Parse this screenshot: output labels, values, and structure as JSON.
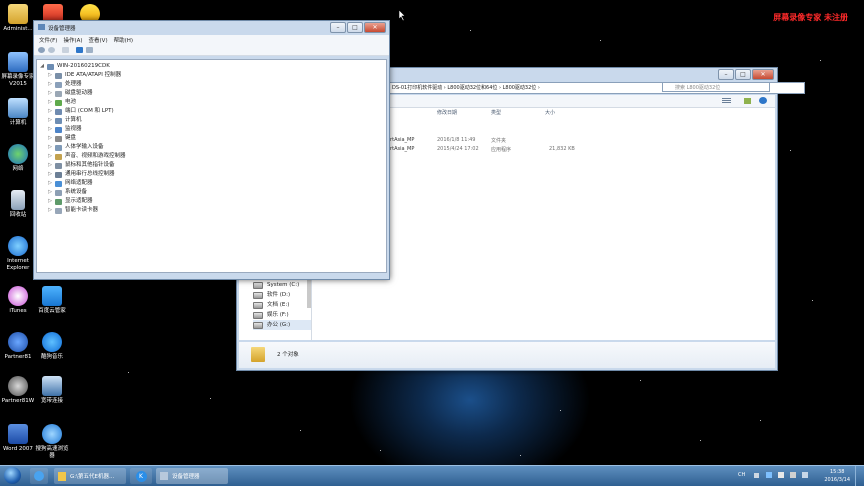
{
  "desktop": {
    "watermark": "屏幕录像专家  未注册",
    "icons": [
      {
        "label": "Administ...",
        "icon": "user-folder-icon"
      },
      {
        "label": "",
        "icon": "app-red-icon"
      },
      {
        "label": "",
        "icon": "app-yellow-icon"
      },
      {
        "label": "屏幕录像专家\nV2015",
        "icon": "screen-recorder-icon"
      },
      {
        "label": "计算机",
        "icon": "computer-icon"
      },
      {
        "label": "网络",
        "icon": "network-icon"
      },
      {
        "label": "回收站",
        "icon": "recycle-bin-icon"
      },
      {
        "label": "Internet\nExplorer",
        "icon": "ie-icon"
      },
      {
        "label": "iTunes",
        "icon": "itunes-icon"
      },
      {
        "label": "百度云管家",
        "icon": "baidu-cloud-icon"
      },
      {
        "label": "Partner81",
        "icon": "partner-icon"
      },
      {
        "label": "酷狗音乐",
        "icon": "kugou-icon"
      },
      {
        "label": "Partner81W",
        "icon": "wordpress-icon"
      },
      {
        "label": "宽带连接",
        "icon": "broadband-icon"
      },
      {
        "label": "Word 2007",
        "icon": "word-icon"
      },
      {
        "label": "搜狗高速浏览\n器",
        "icon": "sogou-icon"
      }
    ]
  },
  "devmgr": {
    "title": "设备管理器",
    "menus": [
      "文件(F)",
      "操作(A)",
      "查看(V)",
      "帮助(H)"
    ],
    "root": "WIN-20160219CDK",
    "nodes": [
      "IDE ATA/ATAPI 控制器",
      "处理器",
      "磁盘驱动器",
      "电池",
      "端口 (COM 和 LPT)",
      "计算机",
      "监视器",
      "键盘",
      "人体学输入设备",
      "声音、视频和游戏控制器",
      "鼠标和其他指针设备",
      "通用串行总线控制器",
      "网络适配器",
      "系统设备",
      "显示适配器",
      "智能卡读卡器"
    ]
  },
  "explorer": {
    "path": "DS-01打印机软件驱动  ›  L800驱动32位和64位  ›  L800驱动32位  ›",
    "search_placeholder": "搜索 L800驱动32位",
    "columns": [
      "修改日期",
      "类型",
      "大小"
    ],
    "rows": [
      {
        "name": "ortAsia_MP",
        "date": "2016/1/8 11:49",
        "type": "文件夹",
        "size": ""
      },
      {
        "name": "ortAsia_MP",
        "date": "2015/4/24 17:02",
        "type": "应用程序",
        "size": "21,832 KB"
      }
    ],
    "nav": [
      "System (C:)",
      "软件 (D:)",
      "文档 (E:)",
      "娱乐 (F:)",
      "办公 (G:)"
    ],
    "status": "2 个对象"
  },
  "taskbar": {
    "items": [
      "G:\\第五代E机器...",
      "设备管理器"
    ],
    "lang": "CH",
    "time": "15:38",
    "date": "2016/3/14"
  }
}
